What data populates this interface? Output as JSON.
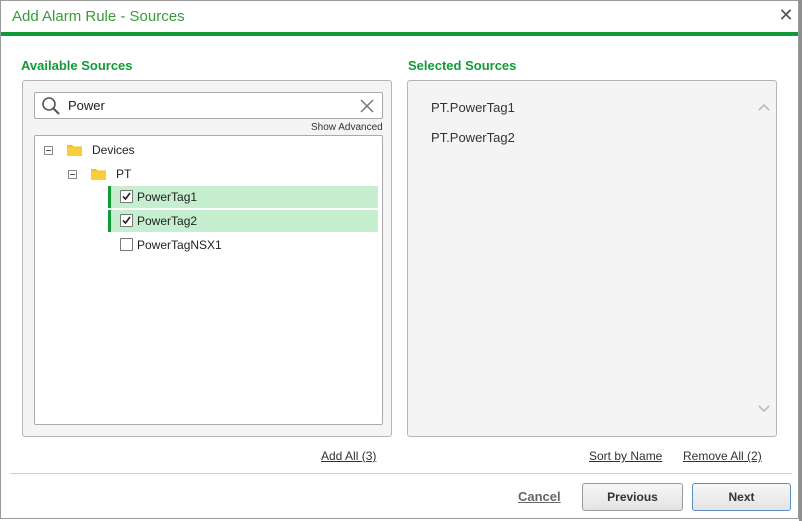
{
  "dialog": {
    "title": "Add Alarm Rule - Sources"
  },
  "available": {
    "label": "Available Sources",
    "search": {
      "value": "Power",
      "placeholder": ""
    },
    "show_advanced": "Show Advanced",
    "tree": {
      "root": "Devices",
      "group": "PT",
      "items": [
        {
          "label": "PowerTag1",
          "checked": true
        },
        {
          "label": "PowerTag2",
          "checked": true
        },
        {
          "label": "PowerTagNSX1",
          "checked": false
        }
      ]
    },
    "add_all": "Add All (3)"
  },
  "selected": {
    "label": "Selected Sources",
    "items": [
      "PT.PowerTag1",
      "PT.PowerTag2"
    ],
    "sort_by_name": "Sort by Name",
    "remove_all": "Remove All (2)"
  },
  "footer": {
    "cancel": "Cancel",
    "previous": "Previous",
    "next": "Next"
  },
  "colors": {
    "accent": "#129a38",
    "title": "#3a9a3a",
    "selected_row": "#c5efce",
    "folder": "#f4c321"
  }
}
